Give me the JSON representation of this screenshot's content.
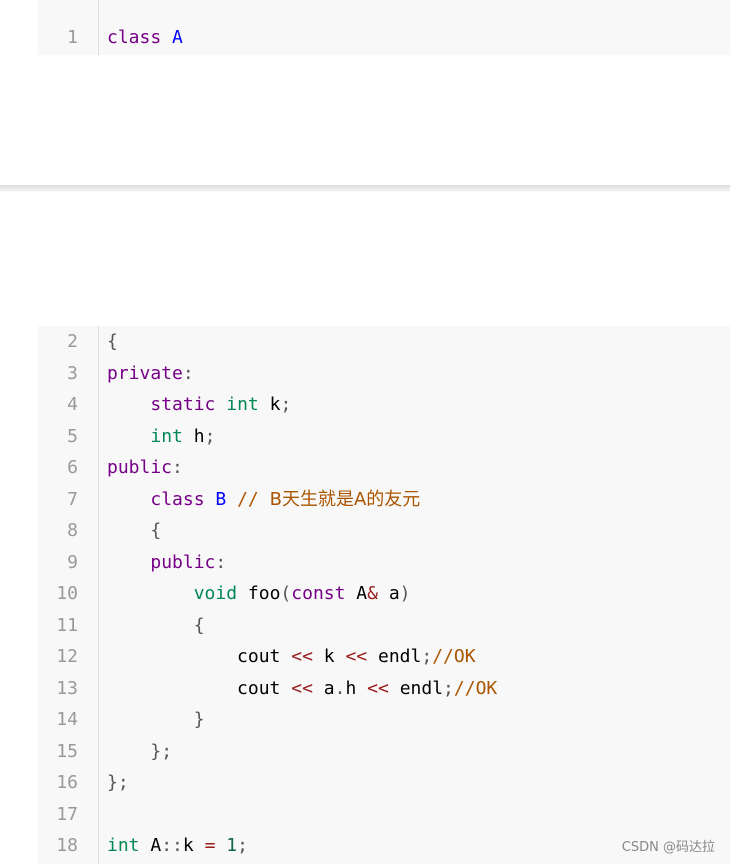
{
  "block1": {
    "lines": [
      {
        "num": "1",
        "t": [
          "class",
          "A"
        ]
      }
    ]
  },
  "block2": {
    "lines": [
      {
        "num": "2",
        "t": [
          "{"
        ]
      },
      {
        "num": "3",
        "t": [
          "private",
          ":"
        ]
      },
      {
        "num": "4",
        "t": [
          "    ",
          "static",
          "int",
          "k",
          ";"
        ]
      },
      {
        "num": "5",
        "t": [
          "    ",
          "int",
          "h",
          ";"
        ]
      },
      {
        "num": "6",
        "t": [
          "public",
          ":"
        ]
      },
      {
        "num": "7",
        "t": [
          "    ",
          "class",
          "B",
          "//",
          "B天生就是A的友元"
        ]
      },
      {
        "num": "8",
        "t": [
          "    ",
          "{"
        ]
      },
      {
        "num": "9",
        "t": [
          "    ",
          "public",
          ":"
        ]
      },
      {
        "num": "10",
        "t": [
          "        ",
          "void",
          "foo",
          "(",
          "const",
          "A",
          "&",
          "a",
          ")"
        ]
      },
      {
        "num": "11",
        "t": [
          "        ",
          "{"
        ]
      },
      {
        "num": "12",
        "t": [
          "            ",
          "cout",
          "<<",
          "k",
          "<<",
          "endl",
          ";",
          "//OK"
        ]
      },
      {
        "num": "13",
        "t": [
          "            ",
          "cout",
          "<<",
          "a",
          ".",
          "h",
          "<<",
          "endl",
          ";",
          "//OK"
        ]
      },
      {
        "num": "14",
        "t": [
          "        ",
          "}"
        ]
      },
      {
        "num": "15",
        "t": [
          "    ",
          "}",
          ";"
        ]
      },
      {
        "num": "16",
        "t": [
          "}",
          ";"
        ]
      },
      {
        "num": "17",
        "t": []
      },
      {
        "num": "18",
        "t": [
          "int",
          "A",
          "::",
          "k",
          "=",
          "1",
          ";"
        ]
      }
    ]
  },
  "watermark": "CSDN @码达拉",
  "colors": {
    "keyword": "#770088",
    "type": "#008855",
    "class_name": "#0000ff",
    "operator": "#981a1a",
    "punctuation": "#555555",
    "number": "#116644",
    "comment": "#aa5500",
    "line_number": "#999999",
    "code_background": "#f8f8f8"
  }
}
